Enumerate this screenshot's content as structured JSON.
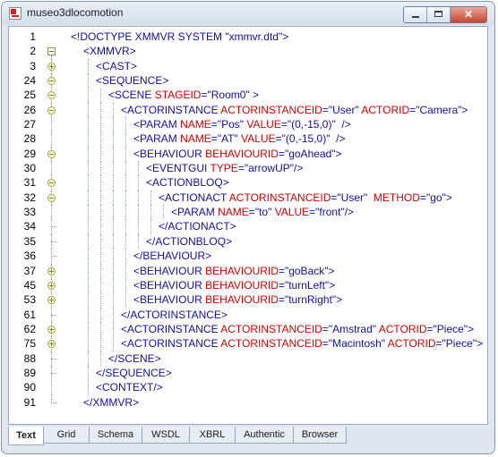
{
  "window": {
    "title": "museo3dlocomotion",
    "close_glyph": "✕"
  },
  "colors": {
    "tag": "#10109a",
    "attribute": "#d00000",
    "value": "#10109a",
    "line_number": "#000000",
    "fold_marker": "#a1a82a"
  },
  "editor": {
    "lines": [
      {
        "no": "1",
        "fold": "none",
        "depth": 0,
        "parts": [
          {
            "c": "t",
            "x": "<!DOCTYPE XMMVR SYSTEM \"xmmvr.dtd\">"
          }
        ]
      },
      {
        "no": "2",
        "fold": "box-minus",
        "depth": 1,
        "parts": [
          {
            "c": "t",
            "x": "<XMMVR>"
          }
        ]
      },
      {
        "no": "3",
        "fold": "plus",
        "depth": 2,
        "parts": [
          {
            "c": "t",
            "x": "<CAST>"
          }
        ]
      },
      {
        "no": "24",
        "fold": "minus",
        "depth": 2,
        "parts": [
          {
            "c": "t",
            "x": "<SEQUENCE>"
          }
        ]
      },
      {
        "no": "25",
        "fold": "minus",
        "depth": 3,
        "parts": [
          {
            "c": "t",
            "x": "<SCENE "
          },
          {
            "c": "a",
            "x": "STAGEID"
          },
          {
            "c": "t",
            "x": "="
          },
          {
            "c": "v",
            "x": "\"Room0\""
          },
          {
            "c": "t",
            "x": " >"
          }
        ]
      },
      {
        "no": "26",
        "fold": "minus",
        "depth": 4,
        "parts": [
          {
            "c": "t",
            "x": "<ACTORINSTANCE "
          },
          {
            "c": "a",
            "x": "ACTORINSTANCEID"
          },
          {
            "c": "t",
            "x": "="
          },
          {
            "c": "v",
            "x": "\"User\""
          },
          {
            "c": "t",
            "x": " "
          },
          {
            "c": "a",
            "x": "ACTORID"
          },
          {
            "c": "t",
            "x": "="
          },
          {
            "c": "v",
            "x": "\"Camera\""
          },
          {
            "c": "t",
            "x": ">"
          }
        ]
      },
      {
        "no": "27",
        "fold": "none",
        "depth": 5,
        "parts": [
          {
            "c": "t",
            "x": "<PARAM "
          },
          {
            "c": "a",
            "x": "NAME"
          },
          {
            "c": "t",
            "x": "="
          },
          {
            "c": "v",
            "x": "\"Pos\""
          },
          {
            "c": "t",
            "x": " "
          },
          {
            "c": "a",
            "x": "VALUE"
          },
          {
            "c": "t",
            "x": "="
          },
          {
            "c": "v",
            "x": "\"(0,-15,0)\""
          },
          {
            "c": "t",
            "x": "  />"
          }
        ]
      },
      {
        "no": "28",
        "fold": "none",
        "depth": 5,
        "parts": [
          {
            "c": "t",
            "x": "<PARAM "
          },
          {
            "c": "a",
            "x": "NAME"
          },
          {
            "c": "t",
            "x": "="
          },
          {
            "c": "v",
            "x": "\"AT\""
          },
          {
            "c": "t",
            "x": " "
          },
          {
            "c": "a",
            "x": "VALUE"
          },
          {
            "c": "t",
            "x": "="
          },
          {
            "c": "v",
            "x": "\"(0,-15,0)\""
          },
          {
            "c": "t",
            "x": "  />"
          }
        ]
      },
      {
        "no": "29",
        "fold": "minus",
        "depth": 5,
        "parts": [
          {
            "c": "t",
            "x": "<BEHAVIOUR "
          },
          {
            "c": "a",
            "x": "BEHAVIOURID"
          },
          {
            "c": "t",
            "x": "="
          },
          {
            "c": "v",
            "x": "\"goAhead\""
          },
          {
            "c": "t",
            "x": ">"
          }
        ]
      },
      {
        "no": "30",
        "fold": "none",
        "depth": 6,
        "parts": [
          {
            "c": "t",
            "x": "<EVENTGUI "
          },
          {
            "c": "a",
            "x": "TYPE"
          },
          {
            "c": "t",
            "x": "="
          },
          {
            "c": "v",
            "x": "\"arrowUP\""
          },
          {
            "c": "t",
            "x": "/>"
          }
        ]
      },
      {
        "no": "31",
        "fold": "minus",
        "depth": 6,
        "parts": [
          {
            "c": "t",
            "x": "<ACTIONBLOQ>"
          }
        ]
      },
      {
        "no": "32",
        "fold": "minus",
        "depth": 7,
        "parts": [
          {
            "c": "t",
            "x": "<ACTIONACT "
          },
          {
            "c": "a",
            "x": "ACTORINSTANCEID"
          },
          {
            "c": "t",
            "x": "="
          },
          {
            "c": "v",
            "x": "\"User\""
          },
          {
            "c": "t",
            "x": "  "
          },
          {
            "c": "a",
            "x": "METHOD"
          },
          {
            "c": "t",
            "x": "="
          },
          {
            "c": "v",
            "x": "\"go\""
          },
          {
            "c": "t",
            "x": ">"
          }
        ]
      },
      {
        "no": "33",
        "fold": "none",
        "depth": 8,
        "parts": [
          {
            "c": "t",
            "x": "<PARAM "
          },
          {
            "c": "a",
            "x": "NAME"
          },
          {
            "c": "t",
            "x": "="
          },
          {
            "c": "v",
            "x": "\"to\""
          },
          {
            "c": "t",
            "x": " "
          },
          {
            "c": "a",
            "x": "VALUE"
          },
          {
            "c": "t",
            "x": "="
          },
          {
            "c": "v",
            "x": "\"front\""
          },
          {
            "c": "t",
            "x": "/>"
          }
        ]
      },
      {
        "no": "34",
        "fold": "end",
        "depth": 7,
        "parts": [
          {
            "c": "t",
            "x": "</ACTIONACT>"
          }
        ]
      },
      {
        "no": "35",
        "fold": "end",
        "depth": 6,
        "parts": [
          {
            "c": "t",
            "x": "</ACTIONBLOQ>"
          }
        ]
      },
      {
        "no": "36",
        "fold": "end",
        "depth": 5,
        "parts": [
          {
            "c": "t",
            "x": "</BEHAVIOUR>"
          }
        ]
      },
      {
        "no": "37",
        "fold": "plus",
        "depth": 5,
        "parts": [
          {
            "c": "t",
            "x": "<BEHAVIOUR "
          },
          {
            "c": "a",
            "x": "BEHAVIOURID"
          },
          {
            "c": "t",
            "x": "="
          },
          {
            "c": "v",
            "x": "\"goBack\""
          },
          {
            "c": "t",
            "x": ">"
          }
        ]
      },
      {
        "no": "45",
        "fold": "plus",
        "depth": 5,
        "parts": [
          {
            "c": "t",
            "x": "<BEHAVIOUR "
          },
          {
            "c": "a",
            "x": "BEHAVIOURID"
          },
          {
            "c": "t",
            "x": "="
          },
          {
            "c": "v",
            "x": "\"turnLeft\""
          },
          {
            "c": "t",
            "x": ">"
          }
        ]
      },
      {
        "no": "53",
        "fold": "plus",
        "depth": 5,
        "parts": [
          {
            "c": "t",
            "x": "<BEHAVIOUR "
          },
          {
            "c": "a",
            "x": "BEHAVIOURID"
          },
          {
            "c": "t",
            "x": "="
          },
          {
            "c": "v",
            "x": "\"turnRight\""
          },
          {
            "c": "t",
            "x": ">"
          }
        ]
      },
      {
        "no": "61",
        "fold": "end",
        "depth": 4,
        "parts": [
          {
            "c": "t",
            "x": "</ACTORINSTANCE>"
          }
        ]
      },
      {
        "no": "62",
        "fold": "plus",
        "depth": 4,
        "parts": [
          {
            "c": "t",
            "x": "<ACTORINSTANCE "
          },
          {
            "c": "a",
            "x": "ACTORINSTANCEID"
          },
          {
            "c": "t",
            "x": "="
          },
          {
            "c": "v",
            "x": "\"Amstrad\""
          },
          {
            "c": "t",
            "x": " "
          },
          {
            "c": "a",
            "x": "ACTORID"
          },
          {
            "c": "t",
            "x": "="
          },
          {
            "c": "v",
            "x": "\"Piece\""
          },
          {
            "c": "t",
            "x": ">"
          }
        ]
      },
      {
        "no": "75",
        "fold": "plus",
        "depth": 4,
        "parts": [
          {
            "c": "t",
            "x": "<ACTORINSTANCE "
          },
          {
            "c": "a",
            "x": "ACTORINSTANCEID"
          },
          {
            "c": "t",
            "x": "="
          },
          {
            "c": "v",
            "x": "\"Macintosh\""
          },
          {
            "c": "t",
            "x": " "
          },
          {
            "c": "a",
            "x": "ACTORID"
          },
          {
            "c": "t",
            "x": "="
          },
          {
            "c": "v",
            "x": "\"Piece\""
          },
          {
            "c": "t",
            "x": ">"
          }
        ]
      },
      {
        "no": "88",
        "fold": "end",
        "depth": 3,
        "parts": [
          {
            "c": "t",
            "x": "</SCENE>"
          }
        ]
      },
      {
        "no": "89",
        "fold": "end",
        "depth": 2,
        "parts": [
          {
            "c": "t",
            "x": "</SEQUENCE>"
          }
        ]
      },
      {
        "no": "90",
        "fold": "none",
        "depth": 2,
        "parts": [
          {
            "c": "t",
            "x": "<CONTEXT/>"
          }
        ]
      },
      {
        "no": "91",
        "fold": "end",
        "depth": 1,
        "parts": [
          {
            "c": "t",
            "x": "</XMMVR>"
          }
        ]
      }
    ]
  },
  "tabs": [
    {
      "label": "Text",
      "active": true
    },
    {
      "label": "Grid",
      "active": false
    },
    {
      "label": "Schema",
      "active": false
    },
    {
      "label": "WSDL",
      "active": false
    },
    {
      "label": "XBRL",
      "active": false
    },
    {
      "label": "Authentic",
      "active": false
    },
    {
      "label": "Browser",
      "active": false
    }
  ]
}
